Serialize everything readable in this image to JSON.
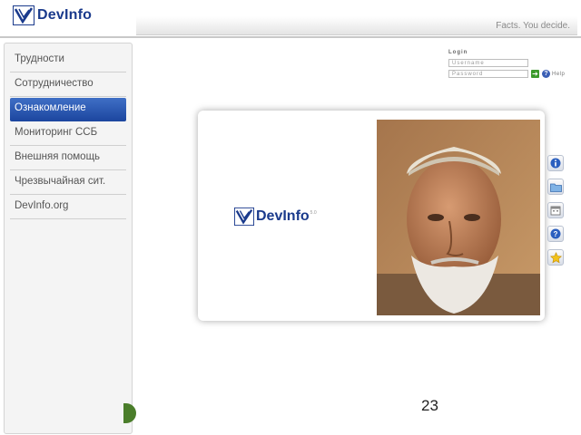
{
  "header": {
    "logo_text": "DevInfo",
    "tagline": "Facts. You decide."
  },
  "sidebar": {
    "items": [
      {
        "label": "Трудности",
        "active": false
      },
      {
        "label": "Сотрудничество",
        "active": false
      },
      {
        "label": "Ознакомление",
        "active": true
      },
      {
        "label": "Мониторинг ССБ",
        "active": false
      },
      {
        "label": "Внешняя помощь",
        "active": false
      },
      {
        "label": "Чрезвычайная сит.",
        "active": false
      },
      {
        "label": "DevInfo.org",
        "active": false
      }
    ]
  },
  "login": {
    "title": "Login",
    "username_placeholder": "Username",
    "password_placeholder": "Password",
    "go_label": "➔",
    "help_icon_label": "?",
    "help_label": "Help"
  },
  "card": {
    "logo_text": "DevInfo",
    "logo_version": "5.0"
  },
  "side_icons": [
    "info-icon",
    "folder-icon",
    "calendar-icon",
    "help-icon",
    "star-icon"
  ],
  "colors": {
    "brand": "#1a3a8c",
    "active_nav": "#2a56b0"
  },
  "page_number": "23"
}
